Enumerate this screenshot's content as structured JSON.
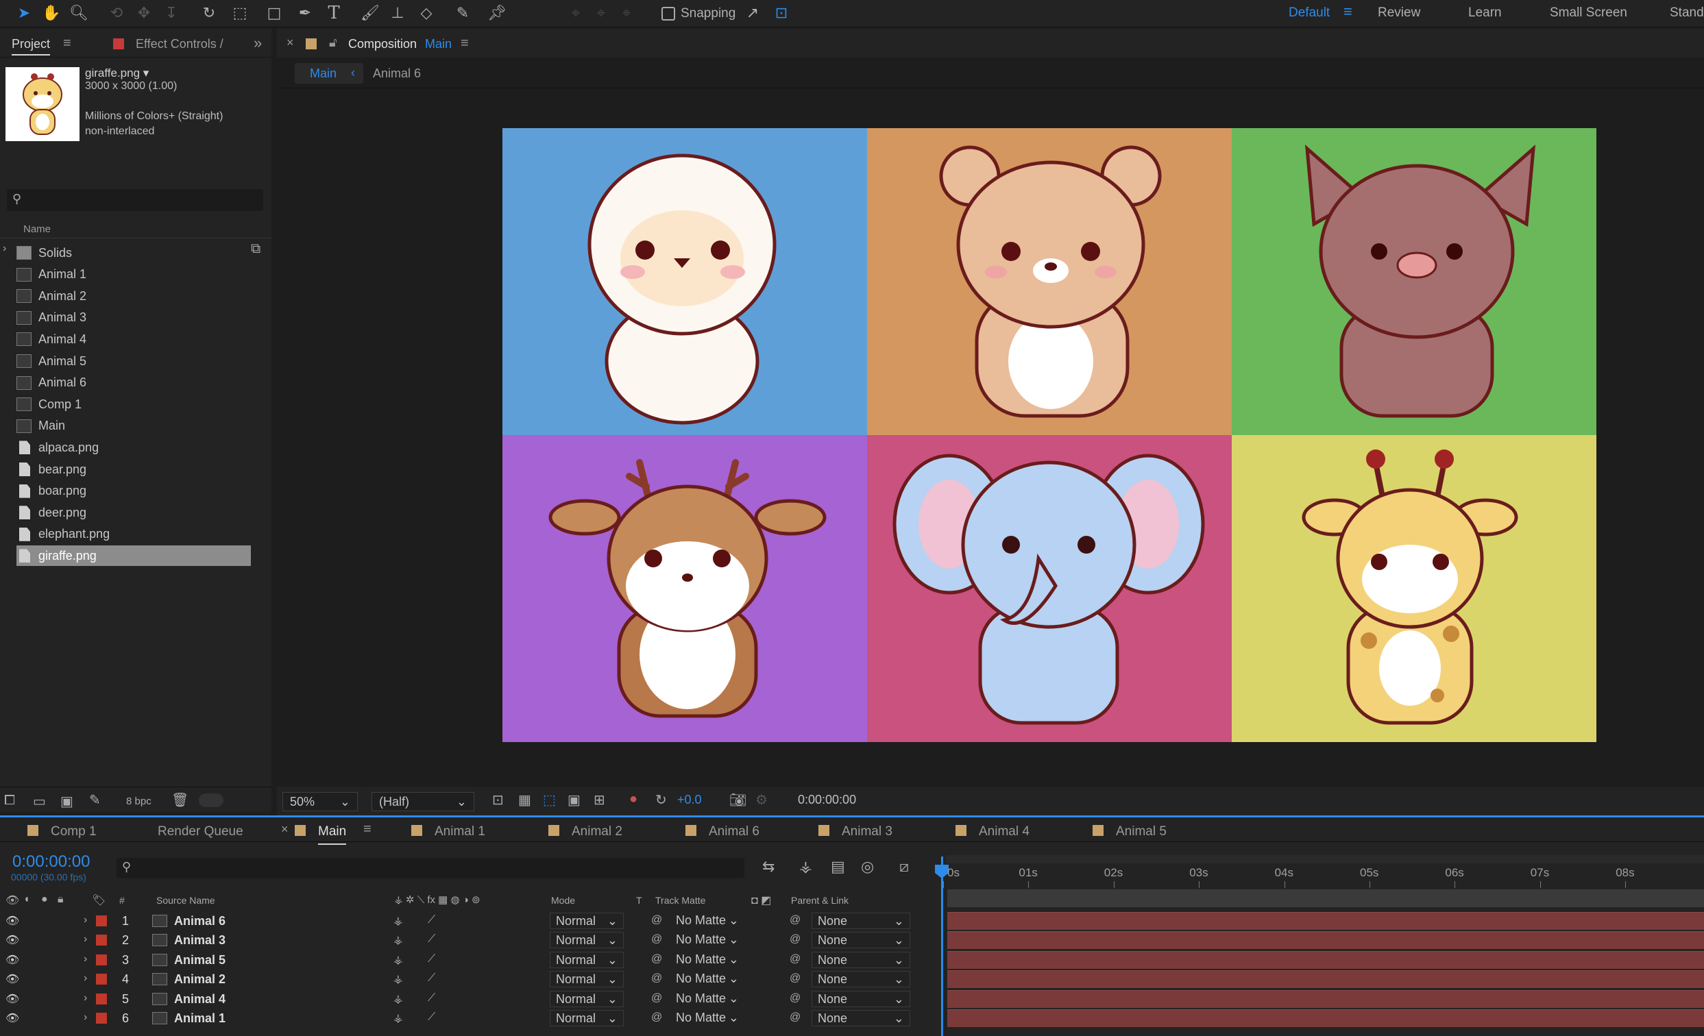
{
  "toolbar": {
    "snapping_label": "Snapping",
    "workspaces": [
      "Default",
      "Review",
      "Learn",
      "Small Screen",
      "Stand"
    ],
    "active_workspace": "Default"
  },
  "project_panel": {
    "tab_project": "Project",
    "tab_effect_controls": "Effect Controls /",
    "selected_file": {
      "name": "giraffe.png ▾",
      "dimensions": "3000 x 3000 (1.00)",
      "color_info": "Millions of Colors+ (Straight)",
      "interlace": "non-interlaced"
    },
    "search_placeholder": "",
    "column_name": "Name",
    "items": [
      {
        "label": "Solids",
        "type": "folder"
      },
      {
        "label": "Animal 1",
        "type": "comp"
      },
      {
        "label": "Animal 2",
        "type": "comp"
      },
      {
        "label": "Animal 3",
        "type": "comp"
      },
      {
        "label": "Animal 4",
        "type": "comp"
      },
      {
        "label": "Animal 5",
        "type": "comp"
      },
      {
        "label": "Animal 6",
        "type": "comp"
      },
      {
        "label": "Comp 1",
        "type": "comp"
      },
      {
        "label": "Main",
        "type": "comp"
      },
      {
        "label": "alpaca.png",
        "type": "file"
      },
      {
        "label": "bear.png",
        "type": "file"
      },
      {
        "label": "boar.png",
        "type": "file"
      },
      {
        "label": "deer.png",
        "type": "file"
      },
      {
        "label": "elephant.png",
        "type": "file"
      },
      {
        "label": "giraffe.png",
        "type": "file",
        "selected": true
      }
    ],
    "bpc_label": "8 bpc"
  },
  "composition_panel": {
    "title_prefix": "Composition",
    "title_name": "Main",
    "breadcrumb": [
      "Main",
      "Animal 6"
    ],
    "zoom": "50%",
    "resolution": "(Half)",
    "exposure": "+0.0",
    "timecode": "0:00:00:00",
    "grid_colors": [
      "#5f9fd8",
      "#d4975f",
      "#6ab85a",
      "#a563d3",
      "#c9527e",
      "#d9d56b"
    ]
  },
  "timeline": {
    "tabs": [
      {
        "label": "Comp 1",
        "color": "#c9a26a"
      },
      {
        "label": "Render Queue",
        "color": ""
      },
      {
        "label": "Main",
        "color": "#c9a26a",
        "active": true
      },
      {
        "label": "Animal 1",
        "color": "#c9a26a"
      },
      {
        "label": "Animal 2",
        "color": "#c9a26a"
      },
      {
        "label": "Animal 6",
        "color": "#c9a26a"
      },
      {
        "label": "Animal 3",
        "color": "#c9a26a"
      },
      {
        "label": "Animal 4",
        "color": "#c9a26a"
      },
      {
        "label": "Animal 5",
        "color": "#c9a26a"
      }
    ],
    "timecode": "0:00:00:00",
    "fps": "00000 (30.00 fps)",
    "columns": {
      "num": "#",
      "source": "Source Name",
      "mode": "Mode",
      "t": "T",
      "track_matte": "Track Matte",
      "parent": "Parent & Link"
    },
    "ruler": [
      "0s",
      "01s",
      "02s",
      "03s",
      "04s",
      "05s",
      "06s",
      "07s",
      "08s"
    ],
    "layers": [
      {
        "num": "1",
        "name": "Animal 6",
        "mode": "Normal",
        "matte": "No Matte",
        "parent": "None"
      },
      {
        "num": "2",
        "name": "Animal 3",
        "mode": "Normal",
        "matte": "No Matte",
        "parent": "None"
      },
      {
        "num": "3",
        "name": "Animal 5",
        "mode": "Normal",
        "matte": "No Matte",
        "parent": "None"
      },
      {
        "num": "4",
        "name": "Animal 2",
        "mode": "Normal",
        "matte": "No Matte",
        "parent": "None"
      },
      {
        "num": "5",
        "name": "Animal 4",
        "mode": "Normal",
        "matte": "No Matte",
        "parent": "None"
      },
      {
        "num": "6",
        "name": "Animal 1",
        "mode": "Normal",
        "matte": "No Matte",
        "parent": "None"
      }
    ]
  }
}
